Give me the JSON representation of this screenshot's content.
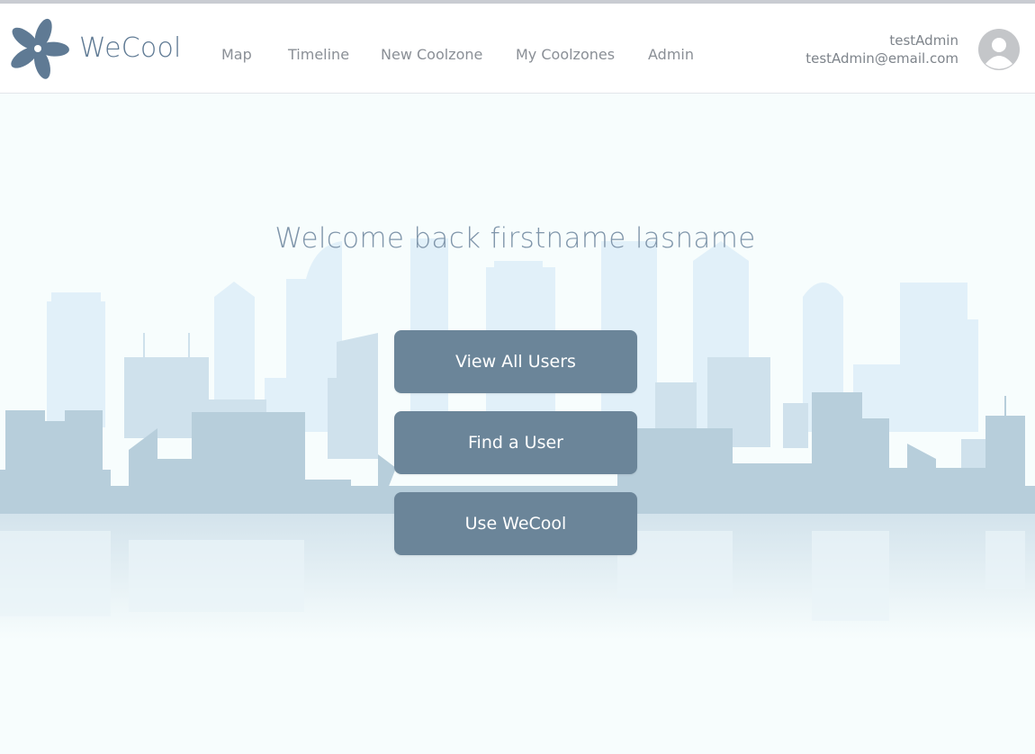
{
  "brand": {
    "name": "WeCool",
    "color": "#5f7a94",
    "icon": "flower-logo-icon"
  },
  "nav": {
    "items": [
      {
        "label": "Map"
      },
      {
        "label": "Timeline"
      },
      {
        "label": "New Coolzone"
      },
      {
        "label": "My Coolzones"
      },
      {
        "label": "Admin"
      }
    ]
  },
  "user": {
    "username": "testAdmin",
    "email": "testAdmin@email.com",
    "avatar_icon": "user-avatar-icon"
  },
  "main": {
    "welcome": "Welcome back firstname lasname",
    "buttons": [
      {
        "label": "View All Users"
      },
      {
        "label": "Find a User"
      },
      {
        "label": "Use WeCool"
      }
    ]
  },
  "colors": {
    "button": "#6b8599",
    "background": "#f7fdfd",
    "skyline": "#b7cedb"
  }
}
